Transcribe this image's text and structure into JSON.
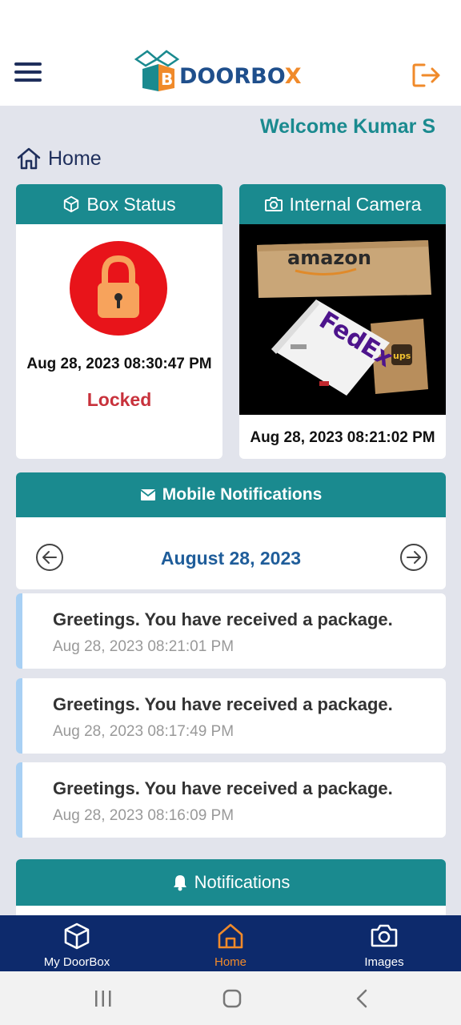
{
  "header": {
    "logo_text_main": "DOORBO",
    "logo_text_x": "X",
    "logo_badge": "B"
  },
  "welcome": "Welcome Kumar S",
  "breadcrumb": {
    "label": "Home"
  },
  "box_status": {
    "title": "Box Status",
    "timestamp": "Aug 28, 2023 08:30:47 PM",
    "state": "Locked"
  },
  "internal_camera": {
    "title": "Internal Camera",
    "timestamp": "Aug 28, 2023 08:21:02 PM",
    "labels": {
      "amazon": "amazon",
      "fedex": "FedEx",
      "ups": "ups"
    }
  },
  "mobile_notifications": {
    "title": "Mobile Notifications",
    "date": "August 28, 2023",
    "items": [
      {
        "message": "Greetings. You have received a package.",
        "time": "Aug 28, 2023 08:21:01 PM"
      },
      {
        "message": "Greetings. You have received a package.",
        "time": "Aug 28, 2023 08:17:49 PM"
      },
      {
        "message": "Greetings. You have received a package.",
        "time": "Aug 28, 2023 08:16:09 PM"
      }
    ]
  },
  "notifications": {
    "title": "Notifications"
  },
  "bottom_nav": {
    "tabs": [
      {
        "label": "My DoorBox",
        "icon": "cube-icon"
      },
      {
        "label": "Home",
        "icon": "home-icon",
        "active": true
      },
      {
        "label": "Images",
        "icon": "camera-icon"
      }
    ]
  },
  "colors": {
    "teal": "#1a8a8f",
    "navy": "#0d2a6c",
    "orange": "#f08a2a",
    "lock_red": "#e8141a",
    "locked_text": "#c8323c"
  }
}
